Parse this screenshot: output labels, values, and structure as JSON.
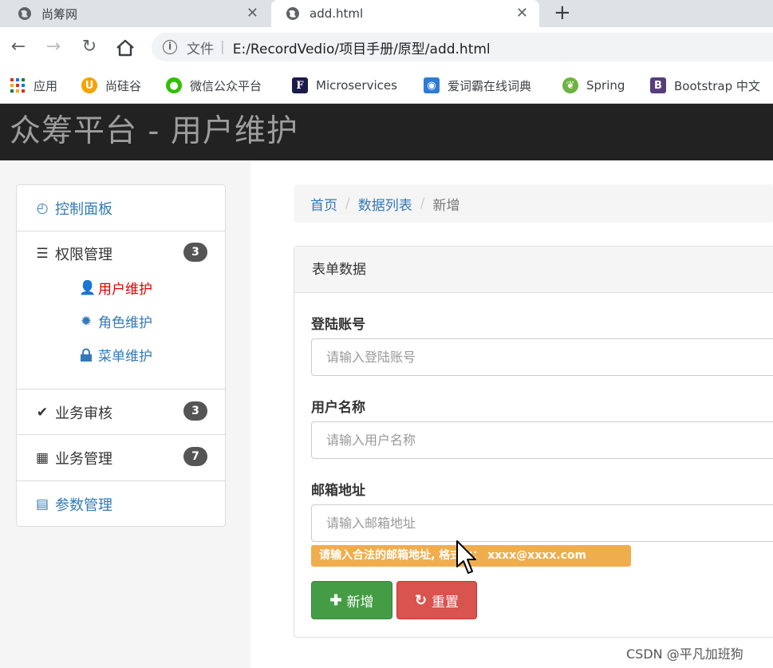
{
  "browser": {
    "tabs": [
      {
        "title": "尚筹网",
        "close": "✕"
      },
      {
        "title": "add.html",
        "close": "✕"
      }
    ],
    "new_tab": "+",
    "address": {
      "scheme_label": "文件",
      "separator": "|",
      "url": "E:/RecordVedio/项目手册/原型/add.html"
    },
    "bookmarks": [
      {
        "label": "应用",
        "icon": "apps-icon"
      },
      {
        "label": "尚硅谷",
        "icon": "atguigu-icon"
      },
      {
        "label": "微信公众平台",
        "icon": "wechat-icon"
      },
      {
        "label": "Microservices",
        "icon": "microservices-icon"
      },
      {
        "label": "爱词霸在线词典",
        "icon": "iciba-icon"
      },
      {
        "label": "Spring",
        "icon": "spring-icon"
      },
      {
        "label": "Bootstrap 中文",
        "icon": "bootstrap-icon"
      }
    ]
  },
  "header": {
    "title": "众筹平台 - 用户维护"
  },
  "sidebar": {
    "items": [
      {
        "label": "控制面板",
        "icon": "dashboard-icon"
      },
      {
        "label": "权限管理",
        "icon": "server-icon",
        "badge": "3",
        "children": [
          {
            "label": "用户维护",
            "icon": "user-icon",
            "active": true
          },
          {
            "label": "角色维护",
            "icon": "certificate-icon"
          },
          {
            "label": "菜单维护",
            "icon": "lock-icon"
          }
        ]
      },
      {
        "label": "业务审核",
        "icon": "check-icon",
        "badge": "3"
      },
      {
        "label": "业务管理",
        "icon": "grid-icon",
        "badge": "7"
      },
      {
        "label": "参数管理",
        "icon": "list-icon"
      }
    ]
  },
  "breadcrumb": {
    "home": "首页",
    "list": "数据列表",
    "current": "新增",
    "separator": "/"
  },
  "form": {
    "panel_title": "表单数据",
    "fields": [
      {
        "label": "登陆账号",
        "placeholder": "请输入登陆账号"
      },
      {
        "label": "用户名称",
        "placeholder": "请输入用户名称"
      },
      {
        "label": "邮箱地址",
        "placeholder": "请输入邮箱地址"
      }
    ],
    "email_hint": "请输入合法的邮箱地址, 格式为： xxxx@xxxx.com",
    "add_button": "新增",
    "reset_button": "重置"
  },
  "watermark": "CSDN @平凡加班狗",
  "colors": {
    "active_menu": "#e00000",
    "link": "#337ab7",
    "success": "#449d44",
    "danger": "#d9534f",
    "warning": "#f0ad4e",
    "navbar": "#222222"
  }
}
